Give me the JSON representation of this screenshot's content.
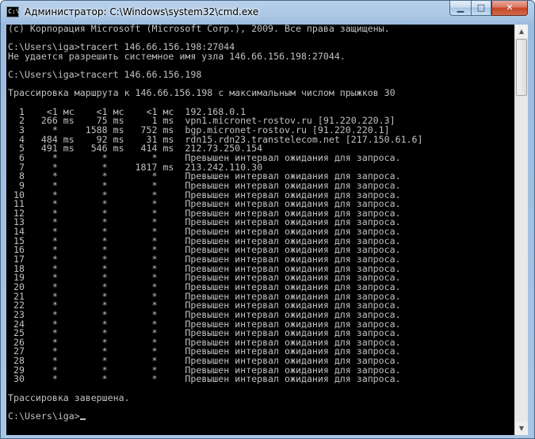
{
  "window": {
    "title": "Администратор: C:\\Windows\\system32\\cmd.exe",
    "icon_text": "C:\\",
    "controls": {
      "minimize": "▁",
      "maximize": "□",
      "close": "✕"
    }
  },
  "console": {
    "lines": [
      "(c) Корпорация Microsoft (Microsoft Corp.), 2009. Все права защищены.",
      "",
      "C:\\Users\\iga>tracert 146.66.156.198:27044",
      "Не удается разрешить системное имя узла 146.66.156.198:27044.",
      "",
      "C:\\Users\\iga>tracert 146.66.156.198",
      "",
      "Трассировка маршрута к 146.66.156.198 с максимальным числом прыжков 30",
      "",
      "  1    <1 мс    <1 мс    <1 мс  192.168.0.1",
      "  2   266 ms    75 ms     1 ms  vpn1.micronet-rostov.ru [91.220.220.3]",
      "  3     *     1588 ms   752 ms  bgp.micronet-rostov.ru [91.220.220.1]",
      "  4   484 ms    92 ms    31 ms  rdn15.rdn23.transtelecom.net [217.150.61.6]",
      "  5   491 ms   546 ms   414 ms  212.73.250.154",
      "  6     *        *        *     Превышен интервал ожидания для запроса.",
      "  7     *        *     1817 ms  213.242.110.30",
      "  8     *        *        *     Превышен интервал ожидания для запроса.",
      "  9     *        *        *     Превышен интервал ожидания для запроса.",
      " 10     *        *        *     Превышен интервал ожидания для запроса.",
      " 11     *        *        *     Превышен интервал ожидания для запроса.",
      " 12     *        *        *     Превышен интервал ожидания для запроса.",
      " 13     *        *        *     Превышен интервал ожидания для запроса.",
      " 14     *        *        *     Превышен интервал ожидания для запроса.",
      " 15     *        *        *     Превышен интервал ожидания для запроса.",
      " 16     *        *        *     Превышен интервал ожидания для запроса.",
      " 17     *        *        *     Превышен интервал ожидания для запроса.",
      " 18     *        *        *     Превышен интервал ожидания для запроса.",
      " 19     *        *        *     Превышен интервал ожидания для запроса.",
      " 20     *        *        *     Превышен интервал ожидания для запроса.",
      " 21     *        *        *     Превышен интервал ожидания для запроса.",
      " 22     *        *        *     Превышен интервал ожидания для запроса.",
      " 23     *        *        *     Превышен интервал ожидания для запроса.",
      " 24     *        *        *     Превышен интервал ожидания для запроса.",
      " 25     *        *        *     Превышен интервал ожидания для запроса.",
      " 26     *        *        *     Превышен интервал ожидания для запроса.",
      " 27     *        *        *     Превышен интервал ожидания для запроса.",
      " 28     *        *        *     Превышен интервал ожидания для запроса.",
      " 29     *        *        *     Превышен интервал ожидания для запроса.",
      " 30     *        *        *     Превышен интервал ожидания для запроса.",
      "",
      "Трассировка завершена.",
      "",
      "C:\\Users\\iga>"
    ]
  },
  "scrollbar": {
    "up_arrow": "▲",
    "down_arrow": "▼",
    "position": 0.0
  }
}
